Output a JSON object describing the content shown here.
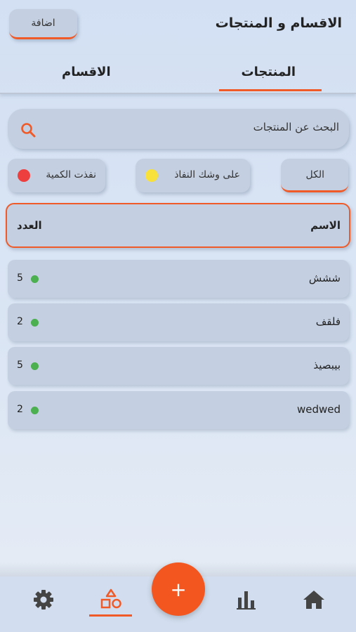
{
  "header": {
    "title": "الاقسام و المنتجات",
    "add_label": "اضافة"
  },
  "tabs": [
    {
      "label": "المنتجات",
      "active": true
    },
    {
      "label": "الاقسام",
      "active": false
    }
  ],
  "search": {
    "placeholder": "البحث عن المنتجات"
  },
  "filters": [
    {
      "label": "الكل",
      "active": true
    },
    {
      "label": "على وشك النفاذ",
      "dot_color": "#f7e13a"
    },
    {
      "label": "نفذت الكمية",
      "dot_color": "#ee3f3f"
    }
  ],
  "table": {
    "headers": {
      "name": "الاسم",
      "count": "العدد"
    },
    "rows": [
      {
        "name": "ششش",
        "count": "5",
        "status_color": "#4caf50"
      },
      {
        "name": "فلقف",
        "count": "2",
        "status_color": "#4caf50"
      },
      {
        "name": "بيبصيذ",
        "count": "5",
        "status_color": "#4caf50"
      },
      {
        "name": "wedwed",
        "count": "2",
        "status_color": "#4caf50"
      }
    ]
  },
  "fab": {
    "label": "+"
  },
  "bottom_nav": [
    {
      "icon": "home-icon"
    },
    {
      "icon": "bar-chart-icon"
    },
    {
      "icon": "shapes-icon",
      "active": true
    },
    {
      "icon": "gear-icon"
    }
  ],
  "colors": {
    "accent": "#f05a28",
    "surface": "#c4d0e1",
    "background": "#d7e2f3"
  }
}
